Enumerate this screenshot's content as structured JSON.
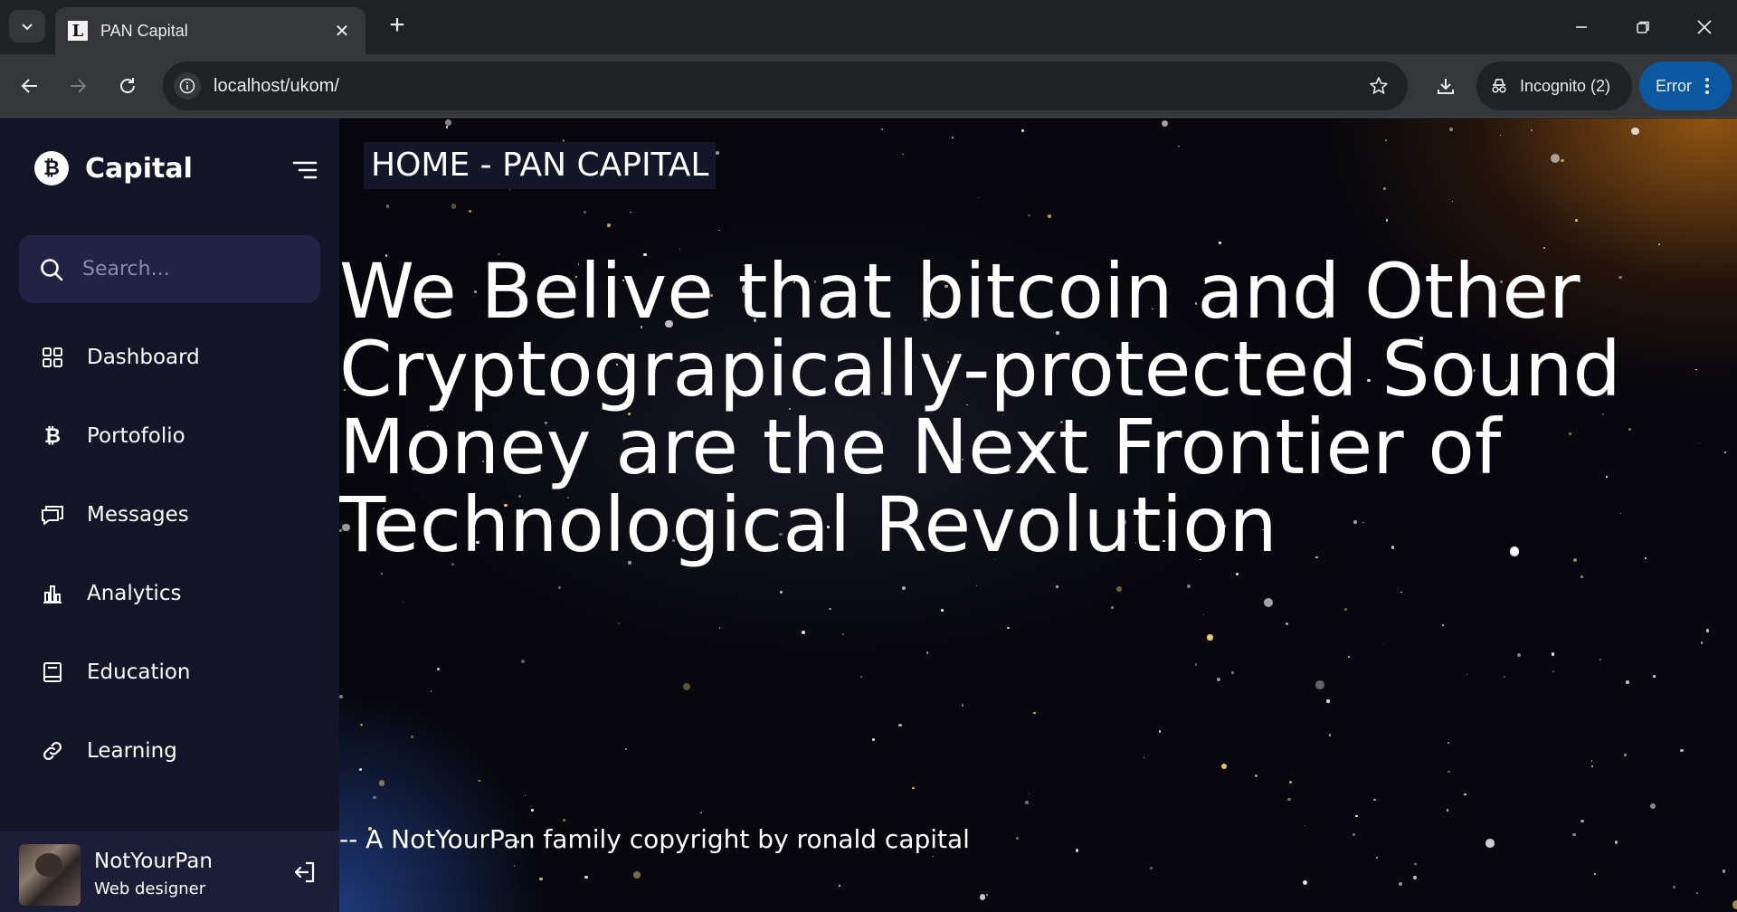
{
  "browser": {
    "tab_title": "PAN Capital",
    "tab_favicon": "L",
    "url": "localhost/ukom/",
    "incognito_label": "Incognito (2)",
    "error_label": "Error"
  },
  "sidebar": {
    "brand_icon": "₿",
    "brand_name": "Capital",
    "search_placeholder": "Search...",
    "items": [
      {
        "label": "Dashboard",
        "icon": "grid-icon"
      },
      {
        "label": "Portofolio",
        "icon": "bitcoin-icon"
      },
      {
        "label": "Messages",
        "icon": "chat-icon"
      },
      {
        "label": "Analytics",
        "icon": "bar-chart-icon"
      },
      {
        "label": "Education",
        "icon": "book-icon"
      },
      {
        "label": "Learning",
        "icon": "link-icon"
      }
    ],
    "profile": {
      "name": "NotYourPan",
      "role": "Web designer"
    }
  },
  "hero": {
    "label": "HOME - PAN CAPITAL",
    "heading": "We Belive that bitcoin and Other Cryptograpically-protected Sound Money are the Next Frontier of Technological Revolution",
    "footer": "-- A NotYourPan family copyright by ronald capital"
  }
}
